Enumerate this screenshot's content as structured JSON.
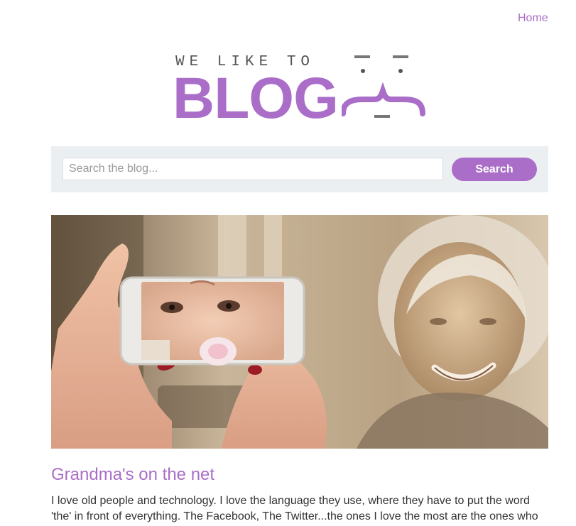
{
  "nav": {
    "home_label": "Home"
  },
  "logo": {
    "tagline": "WE LIKE TO",
    "wordmark": "BLOG"
  },
  "search": {
    "placeholder": "Search the blog...",
    "value": "",
    "button_label": "Search"
  },
  "post": {
    "title": "Grandma's on the net",
    "excerpt": "I love old people and technology. I love the language they use, where they have to put the word 'the' in front of everything. The Facebook, The Twitter...the ones I love the most are the ones who"
  },
  "colors": {
    "accent": "#aa6ec8",
    "search_bg": "#ebeff2",
    "text": "#333333"
  }
}
